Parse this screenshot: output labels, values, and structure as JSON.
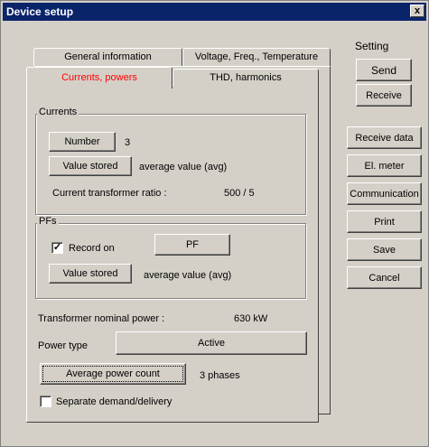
{
  "window": {
    "title": "Device setup",
    "close": "x"
  },
  "tabs": {
    "general": "General information",
    "voltage": "Voltage, Freq., Temperature",
    "currents": "Currents, powers",
    "thd": "THD, harmonics",
    "active_color": "#ff0000"
  },
  "currents": {
    "group_title": "Currents",
    "number_button": "Number",
    "number_value": "3",
    "value_stored_button": "Value stored",
    "value_stored_text": "average value (avg)",
    "ct_ratio_label": "Current transformer ratio :",
    "ct_ratio_value": "500 / 5"
  },
  "pfs": {
    "group_title": "PFs",
    "record_on_label": "Record on",
    "record_on_checked": "✓",
    "pf_button": "PF",
    "value_stored_button": "Value stored",
    "value_stored_text": "average value (avg)"
  },
  "power": {
    "transformer_label": "Transformer nominal power :",
    "transformer_value": "630  kW",
    "power_type_label": "Power type",
    "power_type_button": "Active",
    "avg_power_count_button": "Average power count",
    "avg_power_count_value": "3 phases",
    "separate_label": "Separate demand/delivery"
  },
  "side": {
    "setting_label": "Setting",
    "send": "Send",
    "receive": "Receive",
    "receive_data": "Receive data",
    "el_meter": "El. meter",
    "communication": "Communication",
    "print": "Print",
    "save": "Save",
    "cancel": "Cancel"
  }
}
